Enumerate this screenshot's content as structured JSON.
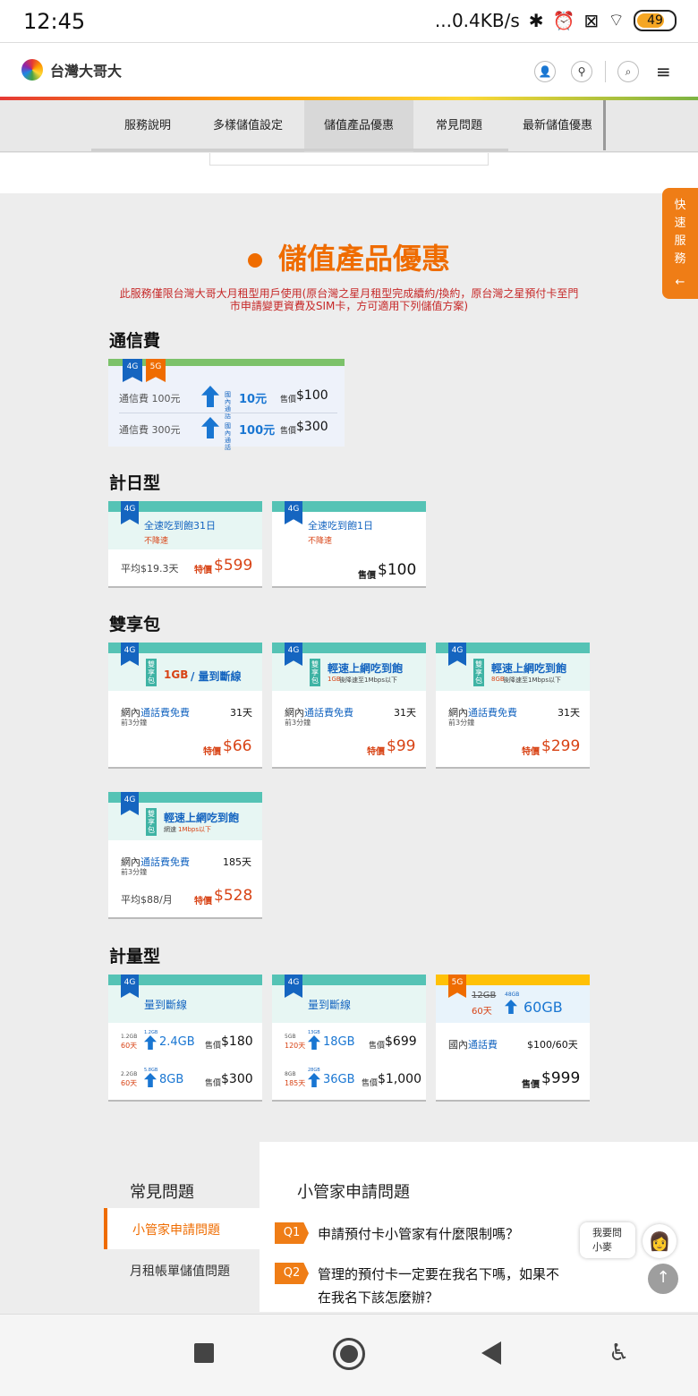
{
  "status_bar": {
    "time": "12:45",
    "net": "...0.4KB/s",
    "battery": "49"
  },
  "header": {
    "brand": "台灣大哥大"
  },
  "tabs": [
    "服務說明",
    "多樣儲值設定",
    "儲值產品優惠",
    "常見問題",
    "最新儲值優惠"
  ],
  "quick_service": [
    "快",
    "速",
    "服",
    "務"
  ],
  "section": {
    "title": "儲值產品優惠",
    "notice_1": "此服務僅限台灣大哥大月租型用戶使用(原台灣之星月租型完成續約/換約，原台灣之星預付卡至門",
    "notice_2": "市申請變更資費及SIM卡，方可適用下列儲值方案)"
  },
  "categories": {
    "telecom": "通信費",
    "daily": "計日型",
    "dual": "雙享包",
    "metered": "計量型"
  },
  "tags": {
    "4g": "4G",
    "5g": "5G"
  },
  "telecom": {
    "rows": [
      {
        "name": "通信費 100元",
        "boost": "加贈",
        "scope": "國內通話",
        "bonus": "10元",
        "price_label": "售價",
        "price": "$100"
      },
      {
        "name": "通信費 300元",
        "boost": "加贈",
        "scope": "國內通話",
        "bonus": "100元",
        "price_label": "售價",
        "price": "$300"
      }
    ]
  },
  "daily": [
    {
      "title": "全速吃到飽31日",
      "sub": "不降速",
      "avg": "平均$19.3天",
      "price_label": "特價",
      "price": "$599"
    },
    {
      "title": "全速吃到飽1日",
      "sub": "不降速",
      "avg": "",
      "price_label": "售價",
      "price": "$100"
    }
  ],
  "dual": {
    "badge": "雙享包",
    "cards": [
      {
        "title_a": "1GB",
        "title_b": " / 量到斷線",
        "sub_a": "",
        "sub_b": "",
        "feature_a": "網內",
        "feature_b": "通話費免費",
        "note": "前3分鐘",
        "days": "31天",
        "avg": "",
        "price_label": "特價",
        "price": "$66"
      },
      {
        "title_a": "輕速上網吃到飽",
        "title_b": "",
        "sub_a": "1GB",
        "sub_b": "後降速至1Mbps以下",
        "feature_a": "網內",
        "feature_b": "通話費免費",
        "note": "前3分鐘",
        "days": "31天",
        "avg": "",
        "price_label": "特價",
        "price": "$99"
      },
      {
        "title_a": "輕速上網吃到飽",
        "title_b": "",
        "sub_a": "8GB",
        "sub_b": "後降速至1Mbps以下",
        "feature_a": "網內",
        "feature_b": "通話費免費",
        "note": "前3分鐘",
        "days": "31天",
        "avg": "",
        "price_label": "特價",
        "price": "$299"
      },
      {
        "title_a": "輕速上網吃到飽",
        "title_b": "",
        "sub_a": "網速",
        "sub_b": "1Mbps以下",
        "feature_a": "網內",
        "feature_b": "通話費免費",
        "note": "前3分鐘",
        "days": "185天",
        "avg": "平均$88/月",
        "price_label": "特價",
        "price": "$528"
      }
    ]
  },
  "metered": [
    {
      "title_a": "量到斷線",
      "rows": [
        {
          "old": "1.2GB",
          "days": "60天",
          "tiny": "1.2GB",
          "amount": "2.4GB",
          "price_label": "售價",
          "price": "$180"
        },
        {
          "old": "2.2GB",
          "days": "60天",
          "tiny": "5.8GB",
          "amount": "8GB",
          "price_label": "售價",
          "price": "$300"
        }
      ]
    },
    {
      "title_a": "量到斷線",
      "rows": [
        {
          "old": "5GB",
          "days": "120天",
          "tiny": "13GB",
          "amount": "18GB",
          "price_label": "售價",
          "price": "$699"
        },
        {
          "old": "8GB",
          "days": "185天",
          "tiny": "28GB",
          "amount": "36GB",
          "price_label": "售價",
          "price": "$1,000"
        }
      ]
    },
    {
      "old": "12GB",
      "days": "60天",
      "tiny": "48GB",
      "amount": "60GB",
      "feature_a": "國內",
      "feature_b": "通話費",
      "feature_price": "$100/60天",
      "price_label": "售價",
      "price": "$999"
    }
  ],
  "faq": {
    "heading": "常見問題",
    "menu": [
      "小管家申請問題",
      "月租帳單儲值問題"
    ],
    "panel_title": "小管家申請問題",
    "items": [
      {
        "q": "Q1",
        "text": "申請預付卡小管家有什麼限制嗎？"
      },
      {
        "q": "Q2",
        "text": "管理的預付卡一定要在我名下嗎，如果不",
        "text2": "在我名下該怎麼辦？"
      }
    ]
  },
  "assistant": {
    "line1": "我要問",
    "line2": "小麥"
  }
}
